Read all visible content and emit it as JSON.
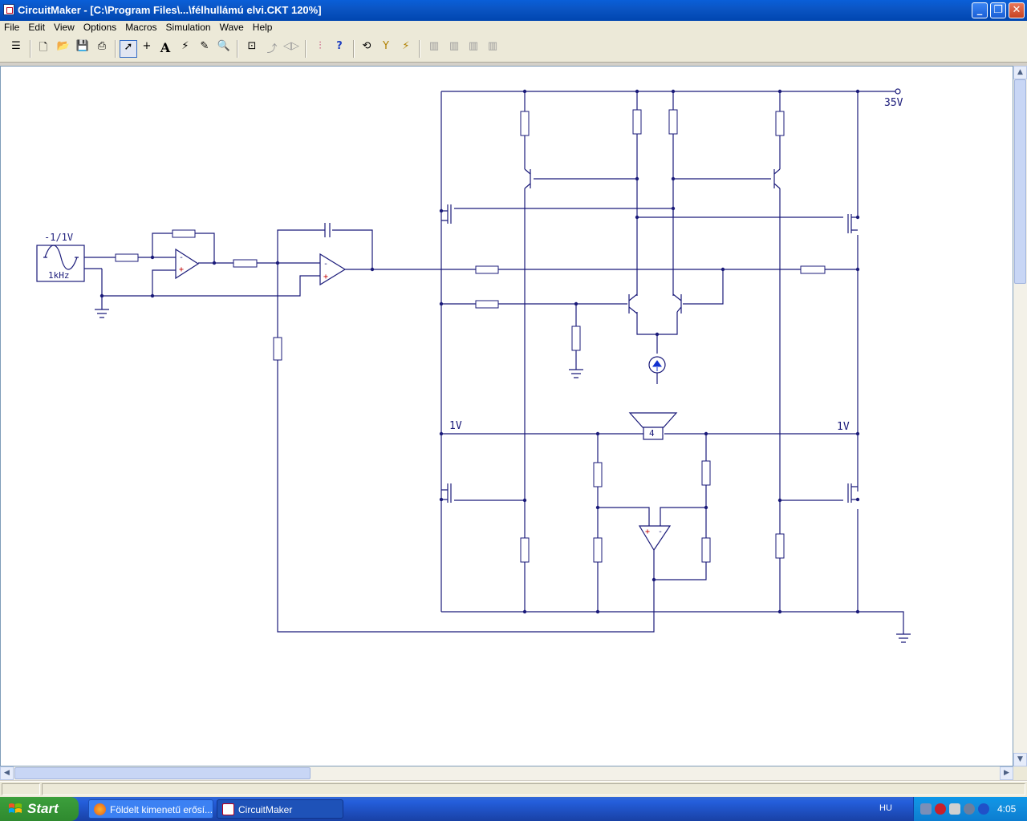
{
  "window": {
    "title": "CircuitMaker - [C:\\Program Files\\...\\félhullámú elvi.CKT 120%]",
    "minimize_icon": "minimize-icon",
    "restore_icon": "restore-icon",
    "close_icon": "close-icon"
  },
  "menu": {
    "items": [
      "File",
      "Edit",
      "View",
      "Options",
      "Macros",
      "Simulation",
      "Wave",
      "Help"
    ]
  },
  "toolbar": {
    "icons": [
      "component-toggle-icon",
      "new-file-icon",
      "open-file-icon",
      "save-icon",
      "print-icon",
      "arrow-tool-icon",
      "wire-tool-icon",
      "text-tool-icon",
      "probe-tool-icon",
      "pen-tool-icon",
      "zoom-tool-icon",
      "zoom-window-icon",
      "rotate-icon",
      "mirror-icon",
      "digital-analog-icon",
      "help-icon",
      "reset-icon",
      "step-icon",
      "run-icon",
      "macro-1-icon",
      "macro-2-icon",
      "macro-3-icon",
      "macro-4-icon"
    ]
  },
  "schematic": {
    "supply_label": "35V",
    "source_amplitude": "-1/1V",
    "source_frequency": "1kHz",
    "left_bias_label": "1V",
    "right_bias_label": "1V",
    "speaker_value": "4",
    "op_amp_minus": "-",
    "op_amp_plus": "+"
  },
  "taskbar": {
    "start_label": "Start",
    "tasks": [
      {
        "label": "Földelt kimenetű erősí...",
        "icon": "firefox-icon"
      },
      {
        "label": "CircuitMaker",
        "icon": "circuitmaker-icon"
      }
    ],
    "language": "HU",
    "clock": "4:05"
  },
  "colors": {
    "wire": "#1b1b7a",
    "titlebar": "#0a5fd8",
    "taskbar": "#245edb",
    "start_button": "#3c9f3c",
    "current_source": "#1030d0"
  }
}
